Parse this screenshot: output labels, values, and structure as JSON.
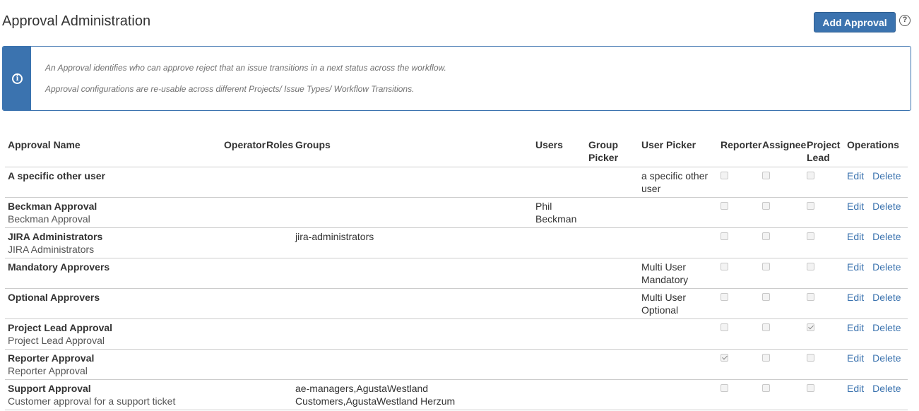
{
  "header": {
    "title": "Approval Administration",
    "add_button": "Add Approval",
    "help_icon": "help-icon",
    "help_glyph": "?"
  },
  "info": {
    "icon": "info-icon",
    "icon_glyph": "i",
    "line1": "An Approval identifies who can approve reject that an issue transitions in a next status across the workflow.",
    "line2": "Approval configurations are re-usable across different Projects/ Issue Types/ Workflow Transitions."
  },
  "table": {
    "columns": {
      "name": "Approval Name",
      "operator": "Operator",
      "roles": "Roles",
      "groups": "Groups",
      "users": "Users",
      "group_picker": "Group Picker",
      "user_picker": "User Picker",
      "reporter": "Reporter",
      "assignee": "Assignee",
      "project_lead": "Project Lead",
      "operations": "Operations"
    },
    "edit_label": "Edit",
    "delete_label": "Delete",
    "rows": [
      {
        "name": "A specific other user",
        "desc": "",
        "groups": "",
        "users": "",
        "user_picker": "a specific other user",
        "reporter": false,
        "assignee": false,
        "project_lead": false
      },
      {
        "name": "Beckman Approval",
        "desc": "Beckman Approval",
        "groups": "",
        "users": "Phil Beckman",
        "user_picker": "",
        "reporter": false,
        "assignee": false,
        "project_lead": false
      },
      {
        "name": "JIRA Administrators",
        "desc": "JIRA Administrators",
        "groups": "jira-administrators",
        "users": "",
        "user_picker": "",
        "reporter": false,
        "assignee": false,
        "project_lead": false
      },
      {
        "name": "Mandatory Approvers",
        "desc": "",
        "groups": "",
        "users": "",
        "user_picker": "Multi User Mandatory",
        "reporter": false,
        "assignee": false,
        "project_lead": false
      },
      {
        "name": "Optional Approvers",
        "desc": "",
        "groups": "",
        "users": "",
        "user_picker": "Multi User Optional",
        "reporter": false,
        "assignee": false,
        "project_lead": false
      },
      {
        "name": "Project Lead Approval",
        "desc": "Project Lead Approval",
        "groups": "",
        "users": "",
        "user_picker": "",
        "reporter": false,
        "assignee": false,
        "project_lead": true
      },
      {
        "name": "Reporter Approval",
        "desc": "Reporter Approval",
        "groups": "",
        "users": "",
        "user_picker": "",
        "reporter": true,
        "assignee": false,
        "project_lead": false
      },
      {
        "name": "Support Approval",
        "desc": "Customer approval for a support ticket",
        "groups": "ae-managers,AgustaWestland Customers,AgustaWestland Herzum",
        "users": "",
        "user_picker": "",
        "reporter": false,
        "assignee": false,
        "project_lead": false
      }
    ]
  },
  "colors": {
    "accent": "#3b73af",
    "link": "#3b73af",
    "border": "#cccccc",
    "text": "#333333"
  }
}
